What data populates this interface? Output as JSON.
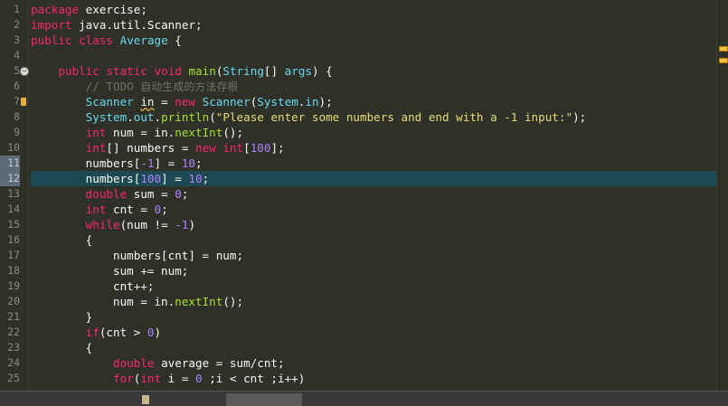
{
  "editor": {
    "line_numbers": [
      "1",
      "2",
      "3",
      "4",
      "5",
      "6",
      "7",
      "8",
      "9",
      "10",
      "11",
      "12",
      "13",
      "14",
      "15",
      "16",
      "17",
      "18",
      "19",
      "20",
      "21",
      "22",
      "23",
      "24",
      "25"
    ],
    "lines": [
      [
        [
          "kw",
          "package"
        ],
        [
          "pl",
          " exercise;"
        ]
      ],
      [
        [
          "kw",
          "import"
        ],
        [
          "pl",
          " java.util.Scanner;"
        ]
      ],
      [
        [
          "kw",
          "public"
        ],
        [
          "pl",
          " "
        ],
        [
          "kw",
          "class"
        ],
        [
          "pl",
          " "
        ],
        [
          "ty",
          "Average"
        ],
        [
          "pl",
          " {"
        ]
      ],
      [],
      [
        [
          "pl",
          "    "
        ],
        [
          "kw",
          "public"
        ],
        [
          "pl",
          " "
        ],
        [
          "kw",
          "static"
        ],
        [
          "pl",
          " "
        ],
        [
          "kw",
          "void"
        ],
        [
          "pl",
          " "
        ],
        [
          "fn",
          "main"
        ],
        [
          "pl",
          "("
        ],
        [
          "ty",
          "String"
        ],
        [
          "pl",
          "[] "
        ],
        [
          "ty",
          "args"
        ],
        [
          "pl",
          ") {"
        ]
      ],
      [
        [
          "pl",
          "        "
        ],
        [
          "cm",
          "// TODO "
        ],
        [
          "cm-cjk",
          "自动生成的方法存根"
        ]
      ],
      [
        [
          "pl",
          "        "
        ],
        [
          "ty",
          "Scanner"
        ],
        [
          "pl",
          " "
        ],
        [
          "squig",
          "in"
        ],
        [
          "pl",
          " = "
        ],
        [
          "kw",
          "new"
        ],
        [
          "pl",
          " "
        ],
        [
          "ty",
          "Scanner"
        ],
        [
          "pl",
          "("
        ],
        [
          "ty",
          "System"
        ],
        [
          "pl",
          "."
        ],
        [
          "ty",
          "in"
        ],
        [
          "pl",
          ");"
        ]
      ],
      [
        [
          "pl",
          "        "
        ],
        [
          "ty",
          "System"
        ],
        [
          "pl",
          "."
        ],
        [
          "ty",
          "out"
        ],
        [
          "pl",
          "."
        ],
        [
          "fn",
          "println"
        ],
        [
          "pl",
          "("
        ],
        [
          "st",
          "\"Please enter some numbers and end with a -1 input:\""
        ],
        [
          "pl",
          ");"
        ]
      ],
      [
        [
          "pl",
          "        "
        ],
        [
          "kw",
          "int"
        ],
        [
          "pl",
          " num = in."
        ],
        [
          "fn",
          "nextInt"
        ],
        [
          "pl",
          "();"
        ]
      ],
      [
        [
          "pl",
          "        "
        ],
        [
          "kw",
          "int"
        ],
        [
          "pl",
          "[] numbers = "
        ],
        [
          "kw",
          "new"
        ],
        [
          "pl",
          " "
        ],
        [
          "kw",
          "int"
        ],
        [
          "pl",
          "["
        ],
        [
          "nu",
          "100"
        ],
        [
          "pl",
          "];"
        ]
      ],
      [
        [
          "pl",
          "        numbers["
        ],
        [
          "nu",
          "-1"
        ],
        [
          "pl",
          "] = "
        ],
        [
          "nu",
          "10"
        ],
        [
          "pl",
          ";"
        ]
      ],
      [
        [
          "pl",
          "        numbers["
        ],
        [
          "nu",
          "100"
        ],
        [
          "pl",
          "] = "
        ],
        [
          "nu",
          "10"
        ],
        [
          "pl",
          ";"
        ]
      ],
      [
        [
          "pl",
          "        "
        ],
        [
          "kw",
          "double"
        ],
        [
          "pl",
          " sum = "
        ],
        [
          "nu",
          "0"
        ],
        [
          "pl",
          ";"
        ]
      ],
      [
        [
          "pl",
          "        "
        ],
        [
          "kw",
          "int"
        ],
        [
          "pl",
          " cnt = "
        ],
        [
          "nu",
          "0"
        ],
        [
          "pl",
          ";"
        ]
      ],
      [
        [
          "pl",
          "        "
        ],
        [
          "kw",
          "while"
        ],
        [
          "pl",
          "(num != "
        ],
        [
          "nu",
          "-1"
        ],
        [
          "pl",
          ")"
        ]
      ],
      [
        [
          "pl",
          "        {"
        ]
      ],
      [
        [
          "pl",
          "            numbers[cnt] = num;"
        ]
      ],
      [
        [
          "pl",
          "            sum += num;"
        ]
      ],
      [
        [
          "pl",
          "            cnt++;"
        ]
      ],
      [
        [
          "pl",
          "            num = in."
        ],
        [
          "fn",
          "nextInt"
        ],
        [
          "pl",
          "();"
        ]
      ],
      [
        [
          "pl",
          "        }"
        ]
      ],
      [
        [
          "pl",
          "        "
        ],
        [
          "kw",
          "if"
        ],
        [
          "pl",
          "(cnt > "
        ],
        [
          "nu",
          "0"
        ],
        [
          "pl",
          ")"
        ]
      ],
      [
        [
          "pl",
          "        {"
        ]
      ],
      [
        [
          "pl",
          "            "
        ],
        [
          "kw",
          "double"
        ],
        [
          "pl",
          " average = sum/cnt;"
        ]
      ],
      [
        [
          "pl",
          "            "
        ],
        [
          "kw",
          "for"
        ],
        [
          "pl",
          "("
        ],
        [
          "kw",
          "int"
        ],
        [
          "pl",
          " i = "
        ],
        [
          "nu",
          "0"
        ],
        [
          "pl",
          " ;i < cnt ;i++)"
        ]
      ]
    ],
    "current_line": 12,
    "selected_band_lines": [
      11,
      12
    ],
    "fold_line": 5,
    "warning_line": 7
  },
  "colors": {
    "background": "#2f3129",
    "keyword": "#f92672",
    "type": "#66d9ef",
    "function": "#a6e22e",
    "string": "#e6db74",
    "number": "#ae81ff",
    "comment": "#75715e",
    "current_line": "#1d4a52"
  }
}
